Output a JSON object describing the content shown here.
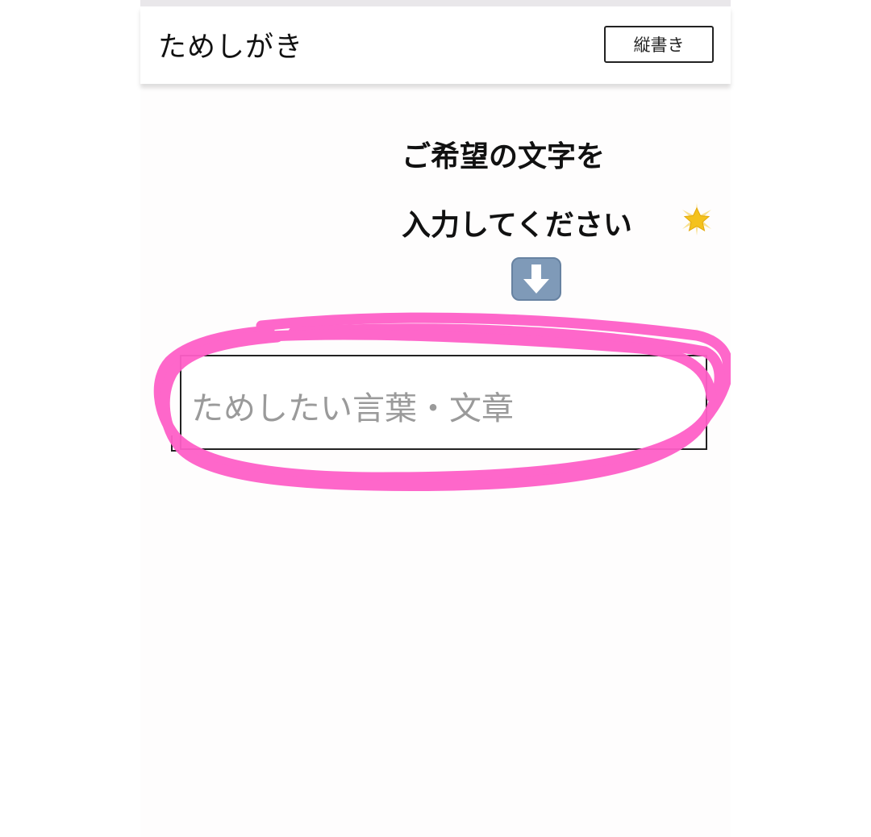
{
  "header": {
    "title": "ためしがき",
    "vertical_button_label": "縦書き"
  },
  "instruction": {
    "line1": "ご希望の文字を",
    "line2": "入力してください"
  },
  "input": {
    "placeholder": "ためしたい言葉・文章",
    "value": ""
  },
  "icons": {
    "sparkle": "glowing-star-icon",
    "arrow": "down-arrow-icon"
  },
  "colors": {
    "highlight": "#ff5fc8",
    "arrow_bg": "#7f9ab8"
  }
}
